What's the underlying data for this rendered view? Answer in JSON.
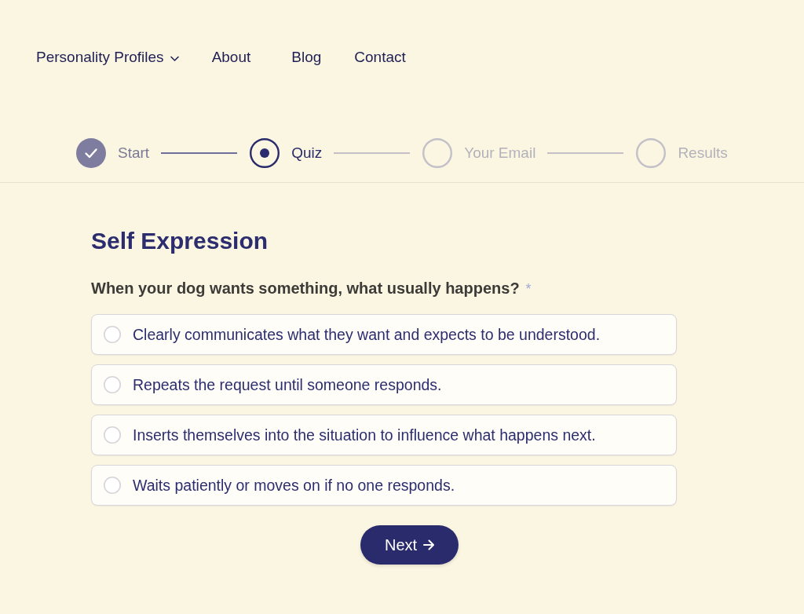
{
  "nav": {
    "items": [
      {
        "label": "Personality Profiles",
        "kind": "dropdown"
      },
      {
        "label": "About",
        "kind": "link"
      },
      {
        "label": "Blog",
        "kind": "link"
      },
      {
        "label": "Contact",
        "kind": "link"
      }
    ]
  },
  "steps": [
    {
      "label": "Start",
      "completed": true,
      "current": false
    },
    {
      "label": "Quiz",
      "completed": false,
      "current": true
    },
    {
      "label": "Your Email",
      "completed": false,
      "current": false
    },
    {
      "label": "Results",
      "completed": false,
      "current": false
    }
  ],
  "section": {
    "title": "Self Expression"
  },
  "question": {
    "text": "When your dog wants something, what usually happens?",
    "required_mark": "*"
  },
  "options": [
    {
      "label": "Clearly communicates what they want and expects to be understood.",
      "selected": false
    },
    {
      "label": "Repeats the request until someone responds.",
      "selected": false
    },
    {
      "label": "Inserts themselves into the situation to influence what happens next.",
      "selected": false
    },
    {
      "label": "Waits patiently or moves on if no one responds.",
      "selected": false
    }
  ],
  "next_button": {
    "label": "Next"
  }
}
